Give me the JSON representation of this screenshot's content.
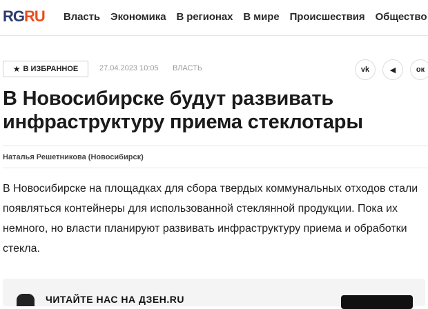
{
  "header": {
    "logo_rg": "RG",
    "logo_ru": "RU",
    "nav": [
      "Власть",
      "Экономика",
      "В регионах",
      "В мире",
      "Происшествия",
      "Общество"
    ]
  },
  "article": {
    "favorite_label": "В ИЗБРАННОЕ",
    "date": "27.04.2023 10:05",
    "rubric": "ВЛАСТЬ",
    "share": {
      "vk": "vk",
      "telegram": "◀",
      "ok": "ок"
    },
    "title": "В Новосибирске будут развивать инфраструктуру приема стеклотары",
    "author": "Наталья Решетникова (Новосибирск)",
    "lead": "В Новосибирске на площадках для сбора твердых коммунальных отходов стали появляться контейнеры для использованной стеклянной продукции. Пока их немного, но власти планируют развивать инфраструктуру приема и обработки стекла."
  },
  "dzen": {
    "text": "ЧИТАЙТЕ НАС НА ДЗЕН.RU"
  },
  "colors": {
    "logo_rg": "#2b3b6b",
    "logo_ru": "#e94e1b",
    "meta_gray": "#9a9a9a"
  },
  "icons": [
    "star-icon",
    "vk-icon",
    "telegram-icon",
    "odnoklassniki-icon",
    "dzen-icon"
  ]
}
